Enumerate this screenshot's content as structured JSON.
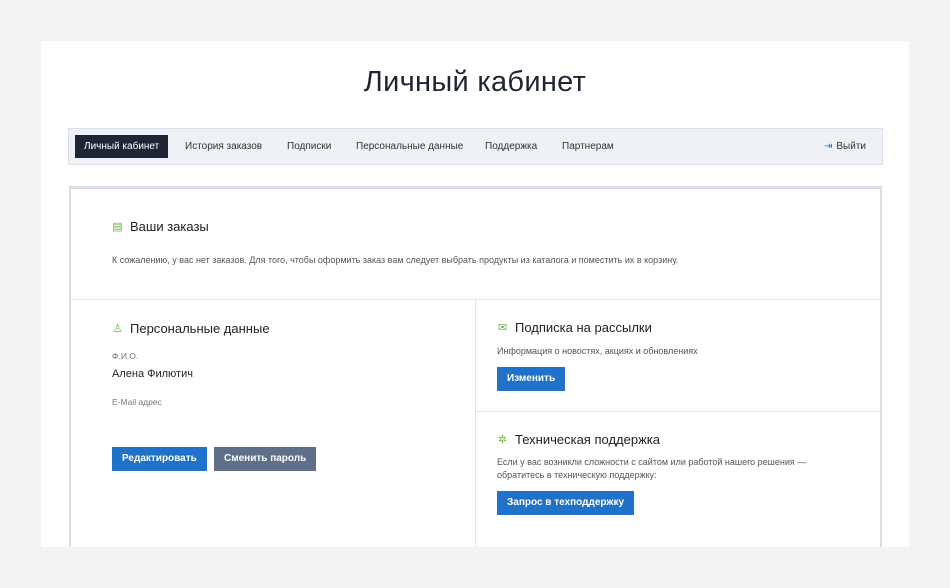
{
  "page_title": "Личный кабинет",
  "nav": {
    "tabs": [
      "Личный кабинет",
      "История заказов",
      "Подписки",
      "Персональные данные",
      "Поддержка",
      "Партнерам"
    ],
    "logout": "Выйти"
  },
  "orders": {
    "title": "Ваши заказы",
    "text": "К сожалению, у вас нет заказов. Для того, чтобы оформить заказ вам следует выбрать продукты из каталога и поместить их в корзину."
  },
  "personal": {
    "title": "Персональные данные",
    "name_label": "Ф.И.О.",
    "name_value": "Алена Филютич",
    "email_label": "E-Mail адрес",
    "edit_button": "Редактировать",
    "password_button": "Сменить пароль"
  },
  "subscription": {
    "title": "Подписка на рассылки",
    "text": "Информация о новостях, акциях и обновлениях",
    "button": "Изменить"
  },
  "support": {
    "title": "Техническая поддержка",
    "text1": "Если у вас возникли сложности с сайтом или работой нашего решения —",
    "text2": "обратитесь в техническую поддержку:",
    "button": "Запрос в техподдержку"
  },
  "colors": {
    "accent": "#1f72c8",
    "icon": "#6cb33f",
    "nav_active": "#1e2535"
  }
}
